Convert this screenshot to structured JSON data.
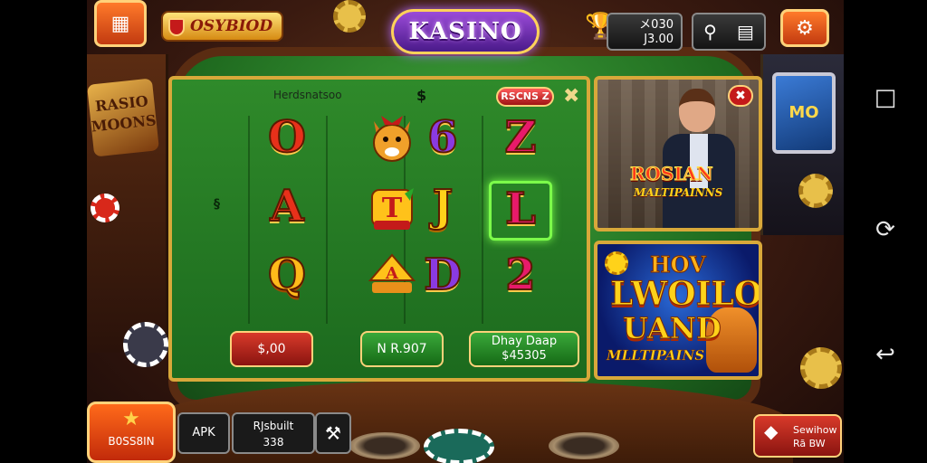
{
  "header": {
    "brand_label": "OSYBIOD",
    "logo_text": "KASINO",
    "balance_line1": "メ030",
    "balance_line2": "J3.00"
  },
  "slot": {
    "title": "Herdsnatsoo",
    "badge": "RSCNS Z",
    "side_mark": "§",
    "symbols": [
      "O",
      "A",
      "Q",
      "6",
      "J",
      "D",
      "Z",
      "L",
      "2"
    ],
    "buttons": {
      "left": "$,00",
      "center": "N R.907",
      "right_line1": "Dhay Daap",
      "right_line2": "$45305"
    }
  },
  "promo_top": {
    "title": "ROSIAN",
    "subtitle": "MALTIPAINNS"
  },
  "promo_bottom": {
    "line1": "HOV",
    "line2": "LWOILO",
    "line3": "UAND",
    "line4": "MLLTIPAINS"
  },
  "bottom_bar": {
    "home_label": "B0SS8IN",
    "apk_label": "APK",
    "result_line1": "RJsbuilt",
    "result_line2": "338",
    "gift_line1": "Sewihow",
    "gift_line2": "Rã BW"
  },
  "icons": {
    "top_left_button": "gift-icon",
    "settings": "gear-icon",
    "search": "search-icon",
    "trophy": "trophy-icon"
  },
  "colors": {
    "accent_gold": "#d8a83a",
    "felt_green": "#2f8a2a",
    "logo_purple": "#6a2ab0",
    "button_red": "#c22a0a"
  }
}
